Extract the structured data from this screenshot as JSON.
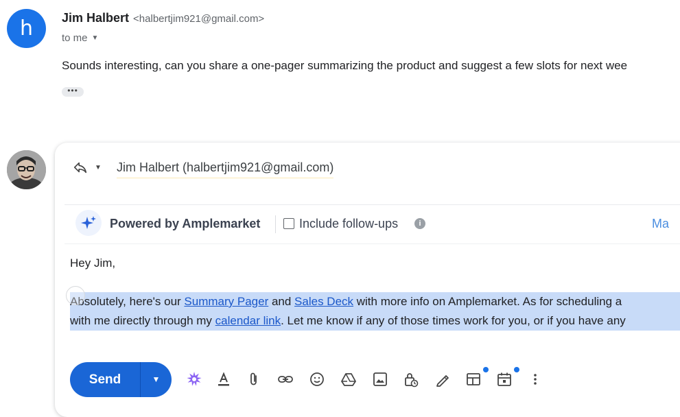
{
  "message": {
    "avatar_letter": "h",
    "sender_name": "Jim Halbert",
    "sender_email": "<halbertjim921@gmail.com>",
    "to_label": "to me",
    "body": "Sounds interesting, can you share a one-pager summarizing the product and suggest a few slots for next wee",
    "trimmed_content_label": "•••"
  },
  "reply": {
    "recipient": "Jim Halbert (halbertjim921@gmail.com)",
    "amplemarket": {
      "powered_by": "Powered by Amplemarket",
      "include_followups": "Include follow-ups",
      "info_glyph": "i",
      "more_label": "Ma"
    },
    "greeting": "Hey Jim,",
    "line1": {
      "t1": "Absolutely, here's our ",
      "link1": "Summary Pager",
      "t2": " and ",
      "link2": "Sales Deck",
      "t3": " with more info on Amplemarket. As for scheduling a"
    },
    "line2": {
      "t1": "with me directly through my ",
      "link1": "calendar link",
      "t2": ". Let me know if any of those times work for you, or if you have any"
    }
  },
  "toolbar": {
    "send_label": "Send",
    "icons": [
      "ai-sparkle-icon",
      "text-format-icon",
      "attach-icon",
      "link-icon",
      "emoji-icon",
      "drive-icon",
      "photo-icon",
      "confidential-icon",
      "signature-icon",
      "template-icon",
      "schedule-icon",
      "more-options-icon"
    ]
  },
  "colors": {
    "accent": "#1a66d6",
    "link": "#1a57c9",
    "selection": "#c8dbf8",
    "sparkle": "#7c5cf0"
  }
}
